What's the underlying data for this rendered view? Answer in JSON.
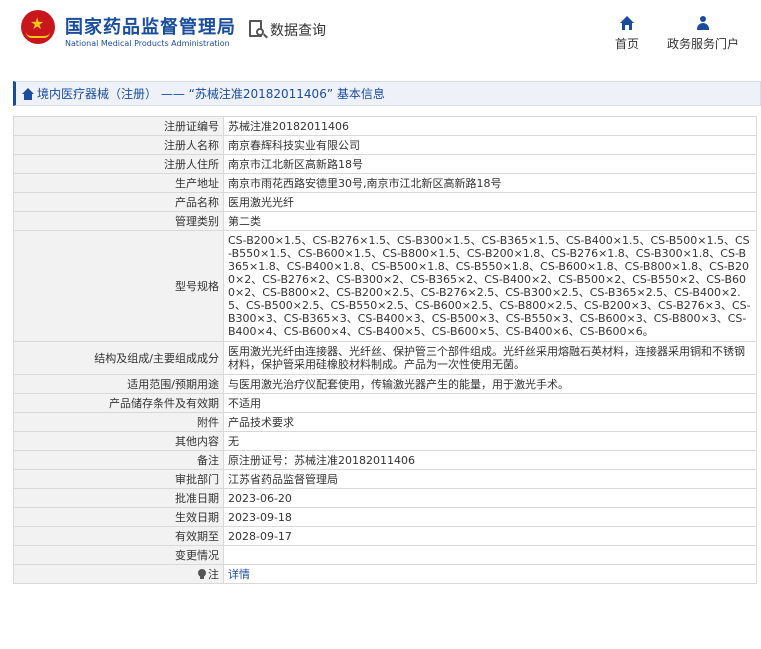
{
  "header": {
    "org_name_cn": "国家药品监督管理局",
    "org_name_en": "National Medical Products Administration",
    "data_query_label": "数据查询",
    "nav": {
      "home_label": "首页",
      "service_label": "政务服务门户"
    }
  },
  "breadcrumb": {
    "text": "境内医疗器械（注册） —— “苏械注准20182011406” 基本信息"
  },
  "details": {
    "rows": [
      {
        "label": "注册证编号",
        "value": "苏械注准20182011406"
      },
      {
        "label": "注册人名称",
        "value": "南京春辉科技实业有限公司"
      },
      {
        "label": "注册人住所",
        "value": "南京市江北新区高新路18号"
      },
      {
        "label": "生产地址",
        "value": "南京市雨花西路安德里30号,南京市江北新区高新路18号"
      },
      {
        "label": "产品名称",
        "value": "医用激光光纤"
      },
      {
        "label": "管理类别",
        "value": "第二类"
      },
      {
        "label": "型号规格",
        "value": "CS-B200×1.5、CS-B276×1.5、CS-B300×1.5、CS-B365×1.5、CS-B400×1.5、CS-B500×1.5、CS-B550×1.5、CS-B600×1.5、CS-B800×1.5、CS-B200×1.8、CS-B276×1.8、CS-B300×1.8、CS-B365×1.8、CS-B400×1.8、CS-B500×1.8、CS-B550×1.8、CS-B600×1.8、CS-B800×1.8、CS-B200×2、CS-B276×2、CS-B300×2、CS-B365×2、CS-B400×2、CS-B500×2、CS-B550×2、CS-B600×2、CS-B800×2、CS-B200×2.5、CS-B276×2.5、CS-B300×2.5、CS-B365×2.5、CS-B400×2.5、CS-B500×2.5、CS-B550×2.5、CS-B600×2.5、CS-B800×2.5、CS-B200×3、CS-B276×3、CS-B300×3、CS-B365×3、CS-B400×3、CS-B500×3、CS-B550×3、CS-B600×3、CS-B800×3、CS-B400×4、CS-B600×4、CS-B400×5、CS-B600×5、CS-B400×6、CS-B600×6。"
      },
      {
        "label": "结构及组成/主要组成成分",
        "value": "医用激光光纤由连接器、光纤丝、保护管三个部件组成。光纤丝采用熔融石英材料，连接器采用铜和不锈钢材料，保护管采用硅橡胶材料制成。产品为一次性使用无菌。"
      },
      {
        "label": "适用范围/预期用途",
        "value": "与医用激光治疗仪配套使用，传输激光器产生的能量，用于激光手术。"
      },
      {
        "label": "产品储存条件及有效期",
        "value": "不适用"
      },
      {
        "label": "附件",
        "value": "产品技术要求"
      },
      {
        "label": "其他内容",
        "value": "无"
      },
      {
        "label": "备注",
        "value": "原注册证号：苏械注准20182011406"
      },
      {
        "label": "审批部门",
        "value": "江苏省药品监督管理局"
      },
      {
        "label": "批准日期",
        "value": "2023-06-20"
      },
      {
        "label": "生效日期",
        "value": "2023-09-18"
      },
      {
        "label": "有效期至",
        "value": "2028-09-17"
      },
      {
        "label": "变更情况",
        "value": ""
      }
    ],
    "note": {
      "label": "注",
      "icon": "lightbulb-icon",
      "link_text": "详情"
    }
  },
  "colors": {
    "brand_blue": "#1a4c9c",
    "label_bg": "#f2f2f2",
    "border": "#d9d9d9"
  }
}
